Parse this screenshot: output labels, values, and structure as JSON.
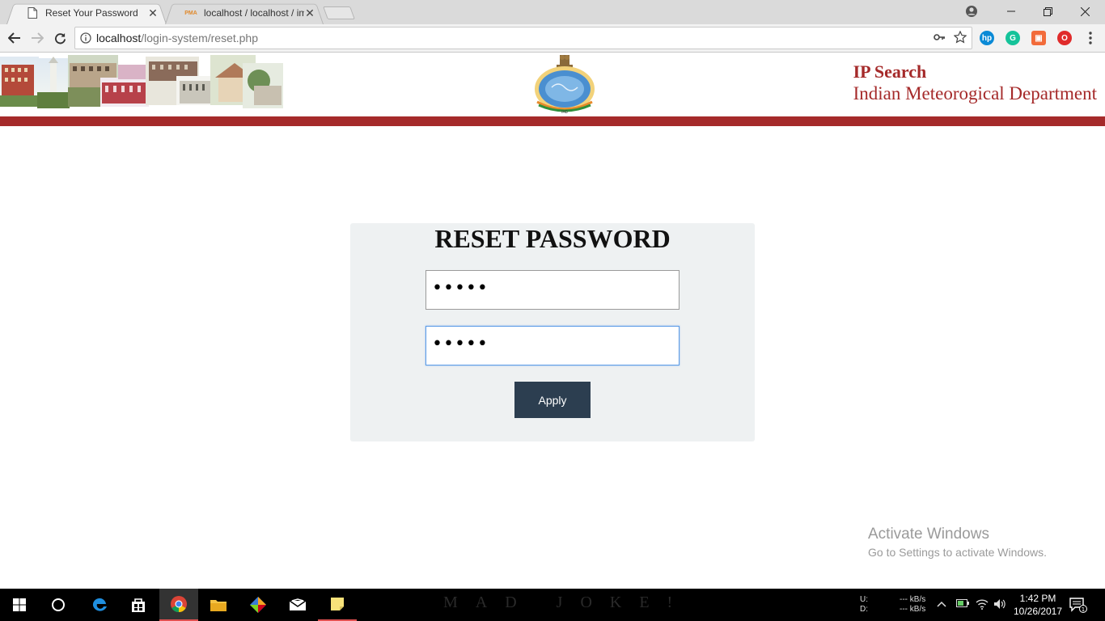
{
  "browser": {
    "tabs": [
      {
        "title": "Reset Your Password",
        "active": true
      },
      {
        "title": "localhost / localhost / im",
        "favicon_text": "PMA",
        "active": false
      }
    ],
    "url_host": "localhost",
    "url_path": "/login-system/reset.php"
  },
  "site": {
    "brand_line1": "IP Search",
    "brand_line2": "Indian Meteorogical Department",
    "accent_color": "#a52a2a"
  },
  "form": {
    "title": "RESET PASSWORD",
    "password_value": "•••••",
    "confirm_value": "•••••",
    "apply_label": "Apply"
  },
  "watermark": {
    "line1": "Activate Windows",
    "line2": "Go to Settings to activate Windows."
  },
  "taskbar": {
    "banner_text": "MAD JOKE!",
    "net_up_label": "U:",
    "net_down_label": "D:",
    "net_up_value": "--- kB/s",
    "net_down_value": "--- kB/s",
    "time": "1:42 PM",
    "date": "10/26/2017",
    "notification_count": "1"
  }
}
